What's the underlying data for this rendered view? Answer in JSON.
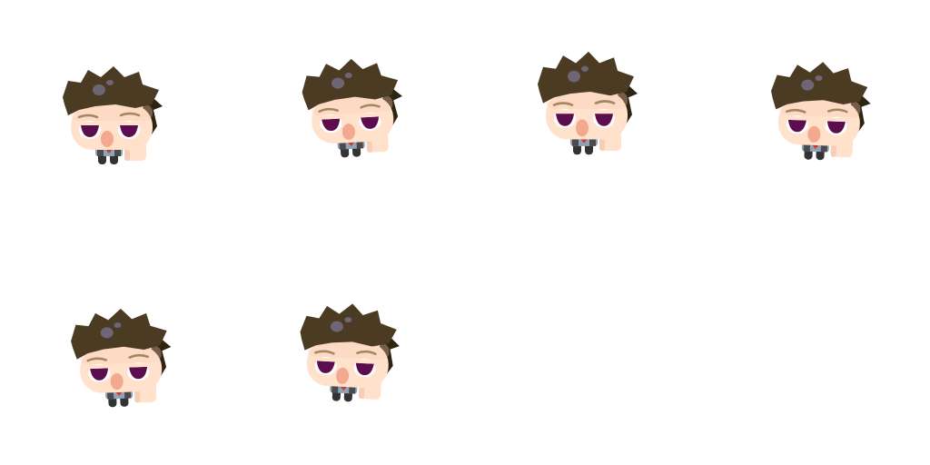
{
  "sprite_sheet": {
    "background": "#ffffff",
    "character": "boy-with-spiky-brown-hair",
    "palette": {
      "hair": "#4a3b22",
      "hair_shadow": "#2f2312",
      "hair_shine": "#6e6577",
      "skin": "#ffe1cc",
      "skin_shade": "#f6cdb5",
      "nose": "#f2a98f",
      "eye_white": "#ffffff",
      "iris": "#5c0d4d",
      "brow": "#a38763",
      "shirt": "#8fa3b8",
      "vest": "#4d4a4e",
      "tie": "#c83a2b",
      "shoes": "#333333"
    },
    "frames": [
      {
        "name": "frame-1",
        "pose": "idle-look-left"
      },
      {
        "name": "frame-2",
        "pose": "idle-look-left-tilt"
      },
      {
        "name": "frame-3",
        "pose": "idle-look-right-tall"
      },
      {
        "name": "frame-4",
        "pose": "idle-look-right"
      },
      {
        "name": "frame-5",
        "pose": "idle-look-left-low"
      },
      {
        "name": "frame-6",
        "pose": "idle-look-left-low-tilt"
      }
    ]
  }
}
